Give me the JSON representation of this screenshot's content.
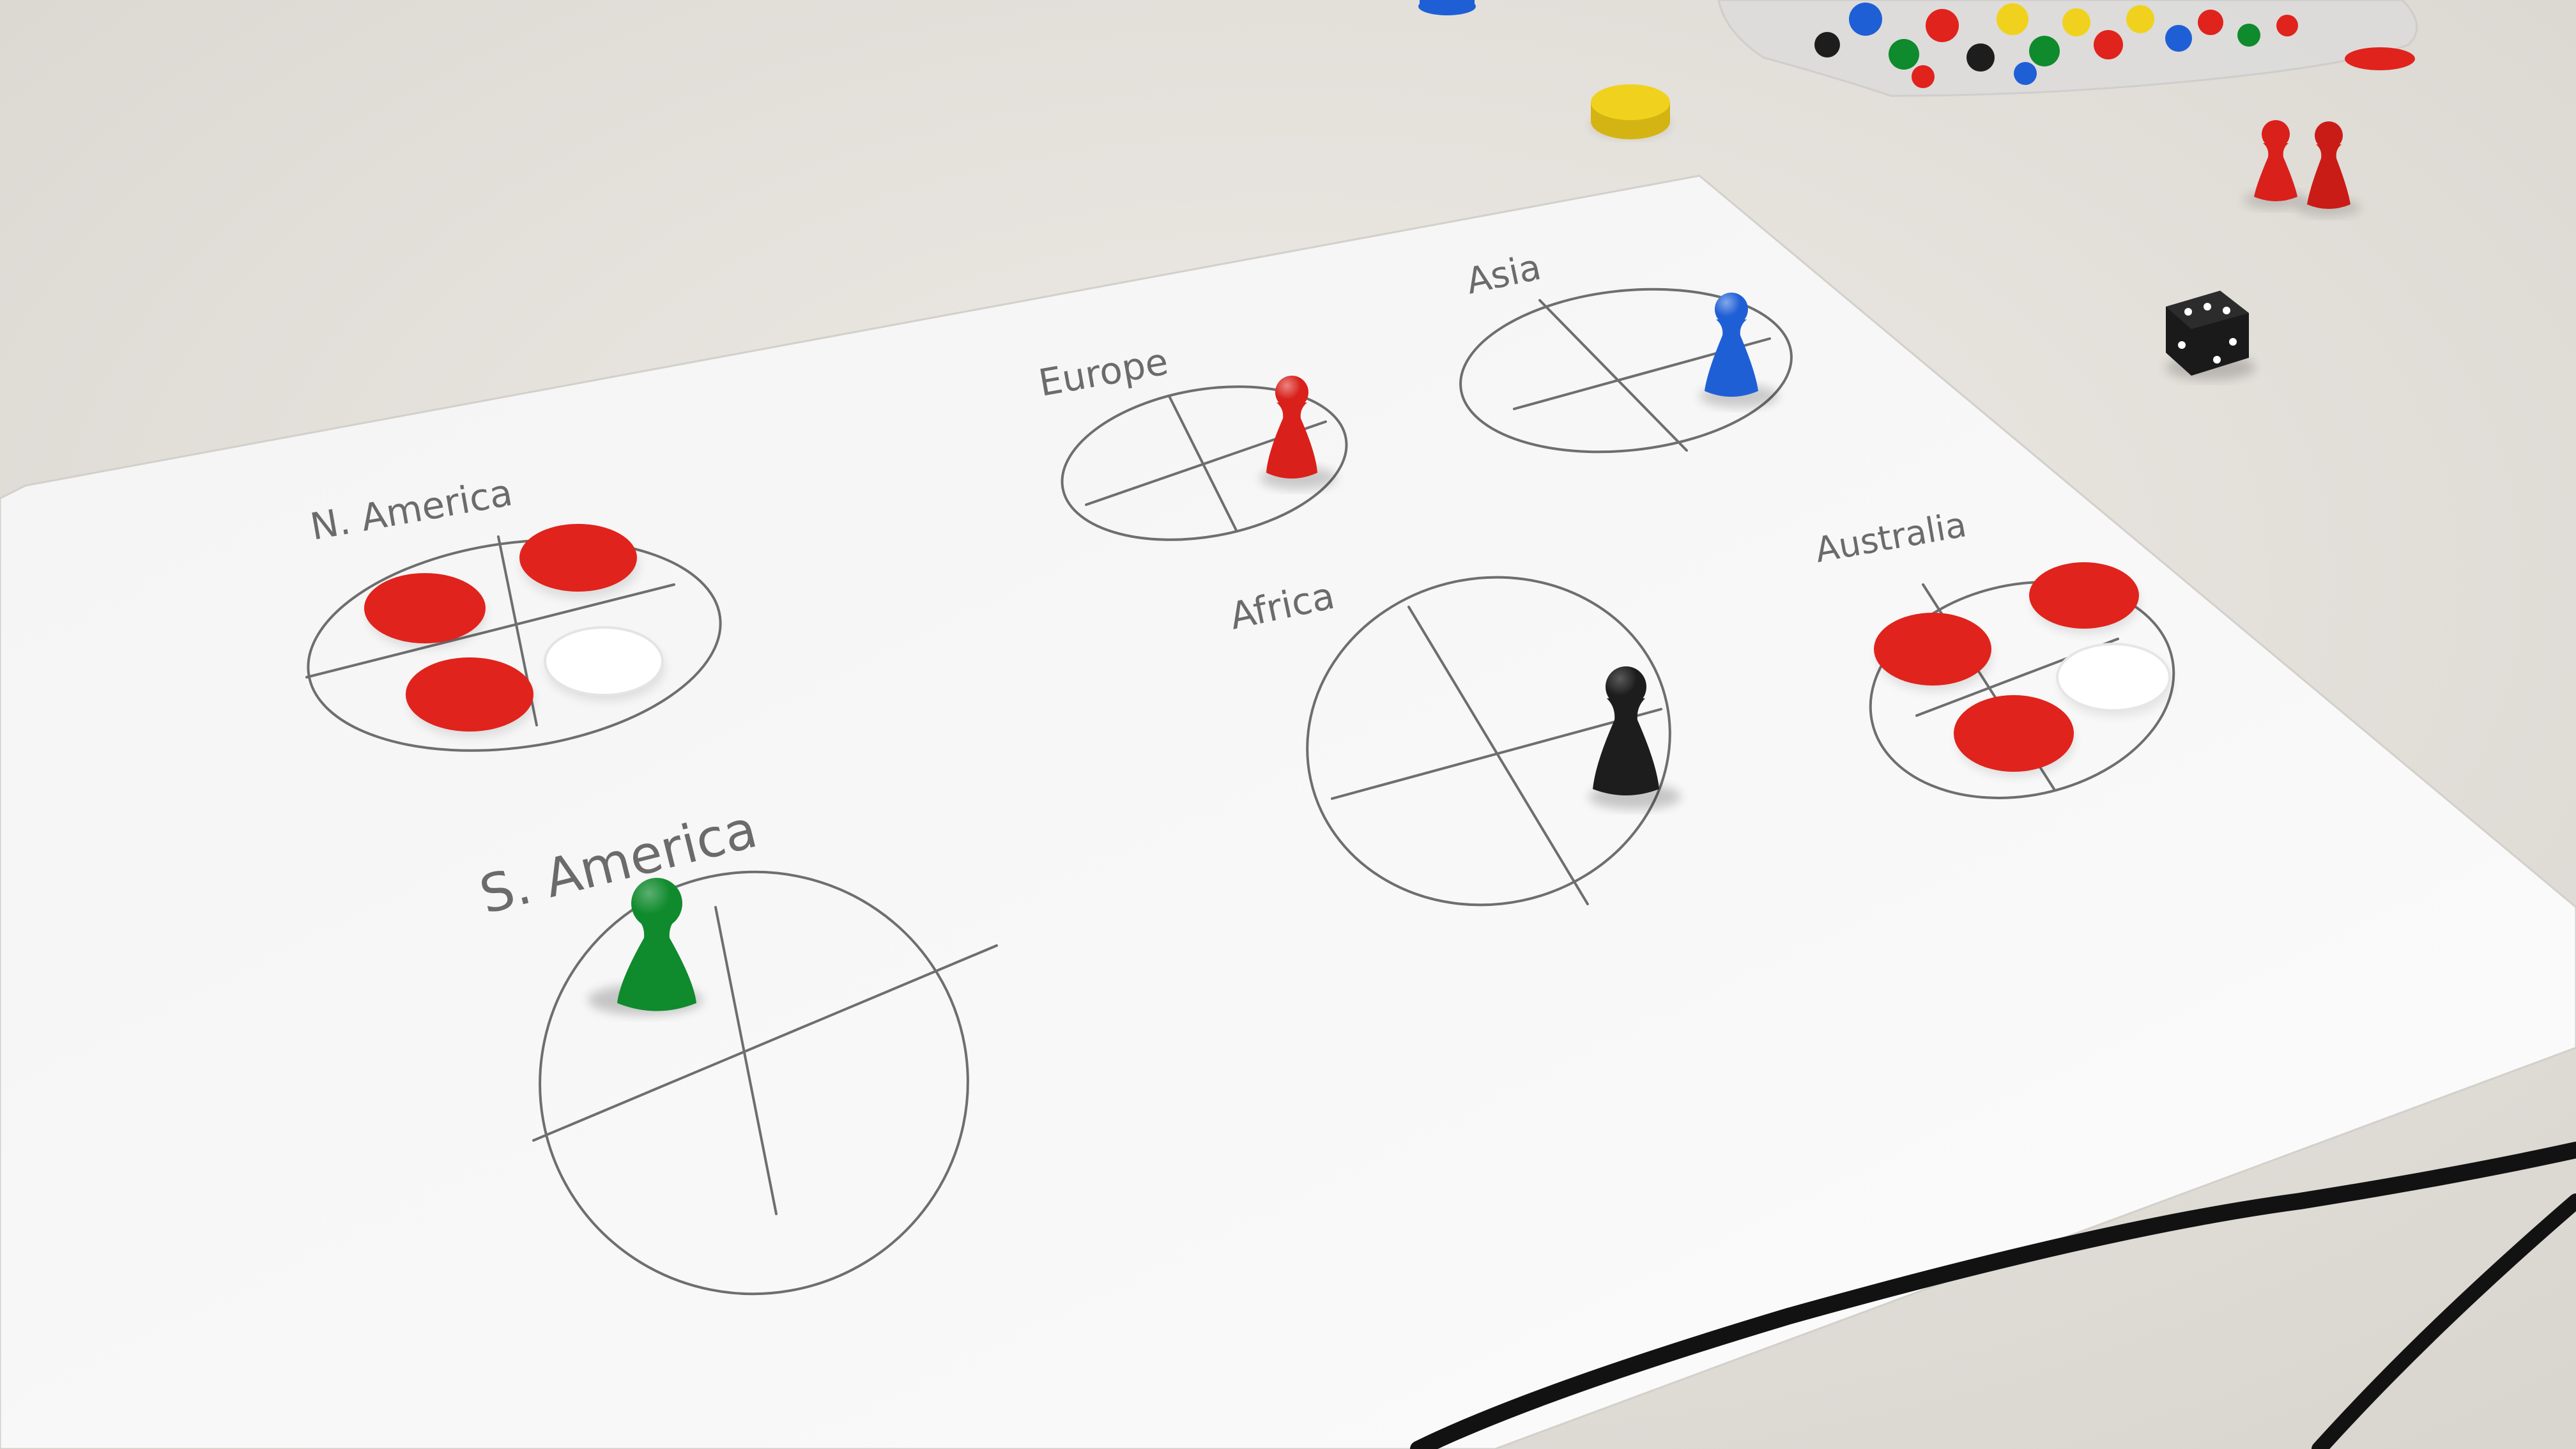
{
  "photo": {
    "subject": "paper game board prototype",
    "surface_color": "#e6e3de",
    "paper_color": "#f7f7f7",
    "ink_color": "#6b6b6b"
  },
  "regions": [
    {
      "id": "n-america",
      "label": "N. America"
    },
    {
      "id": "s-america",
      "label": "S. America"
    },
    {
      "id": "europe",
      "label": "Europe"
    },
    {
      "id": "asia",
      "label": "Asia"
    },
    {
      "id": "africa",
      "label": "Africa"
    },
    {
      "id": "australia",
      "label": "Australia"
    }
  ],
  "pieces": {
    "pawn_colors": {
      "red": "#d9201a",
      "blue": "#1f5fd6",
      "green": "#0f8a2c",
      "black": "#1d1d1d"
    },
    "chip_colors": {
      "red": "#e0231c",
      "white": "#ffffff",
      "yellow": "#f0d21e"
    },
    "icons": [
      "pawn-icon",
      "chip-icon",
      "die-icon",
      "bag-icon",
      "cable-icon"
    ]
  }
}
